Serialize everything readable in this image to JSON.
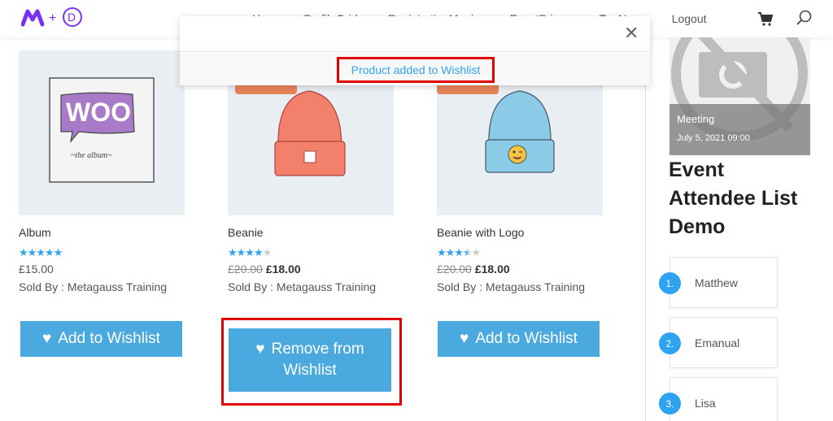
{
  "header": {
    "logo_text": "M+D",
    "nav": [
      {
        "label": "Home",
        "has_dropdown": false
      },
      {
        "label": "ProfileGrid",
        "has_dropdown": true
      },
      {
        "label": "RegistrationMagic",
        "has_dropdown": true
      },
      {
        "label": "EventPrime",
        "has_dropdown": true
      },
      {
        "label": "Try Now",
        "has_dropdown": true
      },
      {
        "label": "Logout",
        "has_dropdown": false
      }
    ],
    "cart_icon": "cart-icon",
    "search_icon": "search-icon"
  },
  "modal": {
    "message": "Product added to Wishlist",
    "close_icon": "close-icon"
  },
  "products": [
    {
      "name": "Album",
      "rating": 5,
      "price": "£15.00",
      "old_price": "",
      "sold_by": "Sold By : Metagauss Training",
      "button_label": "Add to Wishlist",
      "image_text_main": "WOO",
      "image_text_sub": "~the album~"
    },
    {
      "name": "Beanie",
      "rating": 4,
      "price": "£18.00",
      "old_price": "£20.00",
      "sold_by": "Sold By : Metagauss Training",
      "button_label": "Remove from Wishlist",
      "button_line1": "Remove from",
      "button_line2": "Wishlist",
      "image_text_main": "",
      "image_text_sub": ""
    },
    {
      "name": "Beanie with Logo",
      "rating": 3.5,
      "price": "£18.00",
      "old_price": "£20.00",
      "sold_by": "Sold By : Metagauss Training",
      "button_label": "Add to Wishlist",
      "image_text_main": "",
      "image_text_sub": ""
    }
  ],
  "sidebar": {
    "event": {
      "name": "Meeting",
      "date": "July 5, 2021 09:00"
    },
    "title": "Event Attendee List Demo",
    "attendees": [
      {
        "number": "1.",
        "name": "Matthew"
      },
      {
        "number": "2.",
        "name": "Emanual"
      },
      {
        "number": "3.",
        "name": "Lisa"
      }
    ]
  },
  "colors": {
    "accent_blue": "#4aa9de",
    "star_blue": "#2ea3f2",
    "highlight_red": "#e00000",
    "sale_orange": "#e8845a",
    "logo_purple": "#7b2ff7"
  }
}
